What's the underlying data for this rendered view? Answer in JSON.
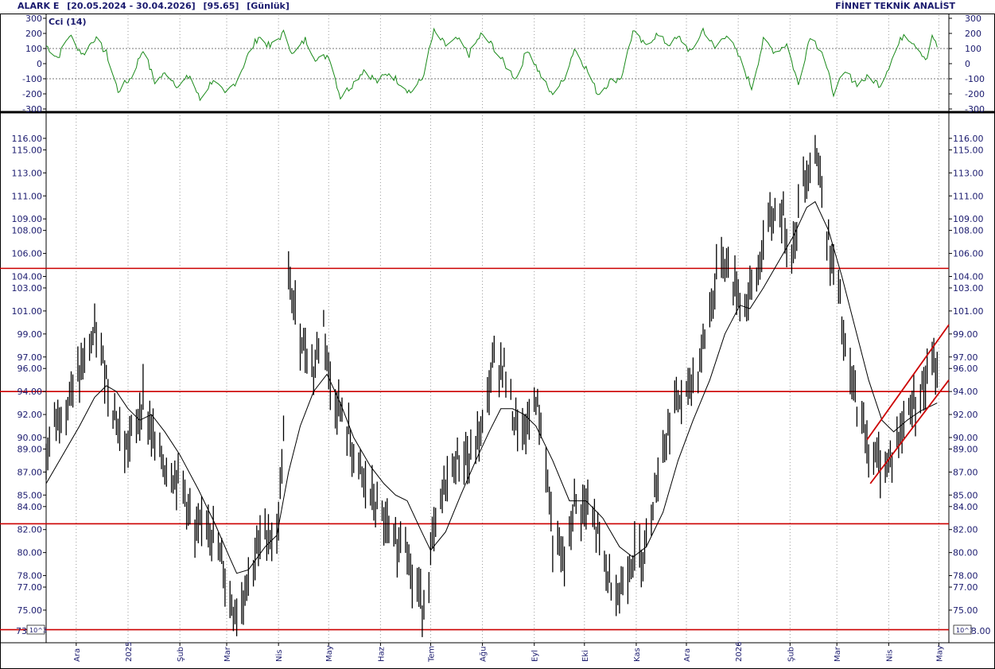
{
  "header": {
    "symbol": "ALARK E",
    "range": "[20.05.2024 - 30.04.2026]",
    "last": "[95.65]",
    "period": "[Günlük]",
    "brand": "FİNNET TEKNİK ANALİST"
  },
  "indicator": {
    "name": "Cci (14)",
    "color": "#1a8a1a",
    "ticks": [
      "300",
      "200",
      "100",
      "0",
      "-100",
      "-200",
      "-300"
    ],
    "tick_values": [
      300,
      200,
      100,
      0,
      -100,
      -200,
      -300
    ],
    "reference_lines": [
      100,
      -100
    ],
    "ylim": [
      -300,
      300
    ]
  },
  "price_axis": {
    "ticks": [
      "116.00",
      "115.00",
      "113.00",
      "111.00",
      "109.00",
      "108.00",
      "106.00",
      "104.00",
      "103.00",
      "101.00",
      "99.00",
      "97.00",
      "96.00",
      "94.00",
      "92.00",
      "90.00",
      "89.00",
      "87.00",
      "85.00",
      "84.00",
      "82.00",
      "80.00",
      "78.00",
      "77.00",
      "75.00"
    ],
    "tick_values": [
      116,
      115,
      113,
      111,
      109,
      108,
      106,
      104,
      103,
      101,
      99,
      97,
      96,
      94,
      92,
      90,
      89,
      87,
      85,
      84,
      82,
      80,
      78,
      77,
      75
    ],
    "bottom_left": "73",
    "bottom_right": "3.00",
    "multiplier": "10^3",
    "ylim": [
      73.2,
      118
    ]
  },
  "months": [
    "Ara",
    "2025",
    "Şub",
    "Mar",
    "Nis",
    "May",
    "Haz",
    "Tem",
    "Ağu",
    "Eyl",
    "Eki",
    "Kas",
    "Ara",
    "2026",
    "Şub",
    "Mar",
    "Nis",
    "May"
  ],
  "colors": {
    "bars": "#000000",
    "ma": "#000000",
    "hlines": "#cc0000",
    "axis_text": "#1a1a6e",
    "grid": "#999999"
  },
  "chart_data": {
    "type": "line",
    "title": "ALARK E [20.05.2024 - 30.04.2026] [95.65] [Günlük]",
    "xlabel": "",
    "ylabel": "",
    "ylim": [
      73.2,
      118
    ],
    "horizontal_levels": [
      104.7,
      94.0,
      82.5,
      73.3
    ],
    "channel": {
      "upper": {
        "from": [
          "2026-03-19",
          89.8
        ],
        "to": [
          "2026-05-07",
          99.8
        ]
      },
      "lower": {
        "from": [
          "2026-03-21",
          86.0
        ],
        "to": [
          "2026-05-07",
          95.0
        ]
      }
    },
    "price_path": [
      [
        "2024-11-13",
        88.0
      ],
      [
        "2024-11-18",
        91.5
      ],
      [
        "2024-11-27",
        93.5
      ],
      [
        "2024-12-06",
        96.5
      ],
      [
        "2024-12-12",
        99.0
      ],
      [
        "2024-12-18",
        96.0
      ],
      [
        "2024-12-25",
        91.5
      ],
      [
        "2024-12-30",
        89.0
      ],
      [
        "2025-01-06",
        91.0
      ],
      [
        "2025-01-10",
        93.5
      ],
      [
        "2025-01-16",
        90.0
      ],
      [
        "2025-01-23",
        87.5
      ],
      [
        "2025-02-03",
        86.0
      ],
      [
        "2025-02-10",
        81.0
      ],
      [
        "2025-02-17",
        83.5
      ],
      [
        "2025-02-25",
        79.5
      ],
      [
        "2025-03-03",
        76.0
      ],
      [
        "2025-03-07",
        74.5
      ],
      [
        "2025-03-14",
        78.0
      ],
      [
        "2025-03-24",
        82.0
      ],
      [
        "2025-03-31",
        81.0
      ],
      [
        "2025-04-04",
        90.0
      ],
      [
        "2025-04-07",
        103.5
      ],
      [
        "2025-04-14",
        99.0
      ],
      [
        "2025-04-22",
        96.0
      ],
      [
        "2025-04-28",
        100.0
      ],
      [
        "2025-05-02",
        94.5
      ],
      [
        "2025-05-12",
        90.5
      ],
      [
        "2025-05-19",
        87.0
      ],
      [
        "2025-05-26",
        85.0
      ],
      [
        "2025-06-03",
        82.5
      ],
      [
        "2025-06-10",
        80.5
      ],
      [
        "2025-06-16",
        82.0
      ],
      [
        "2025-06-20",
        77.5
      ],
      [
        "2025-06-27",
        75.5
      ],
      [
        "2025-07-03",
        81.5
      ],
      [
        "2025-07-10",
        86.0
      ],
      [
        "2025-07-18",
        88.5
      ],
      [
        "2025-07-25",
        88.0
      ],
      [
        "2025-08-01",
        91.0
      ],
      [
        "2025-08-08",
        97.0
      ],
      [
        "2025-08-14",
        96.0
      ],
      [
        "2025-08-20",
        91.5
      ],
      [
        "2025-08-26",
        90.0
      ],
      [
        "2025-09-02",
        93.5
      ],
      [
        "2025-09-08",
        88.0
      ],
      [
        "2025-09-12",
        81.0
      ],
      [
        "2025-09-19",
        79.0
      ],
      [
        "2025-09-25",
        84.0
      ],
      [
        "2025-10-02",
        84.0
      ],
      [
        "2025-10-08",
        82.0
      ],
      [
        "2025-10-15",
        78.0
      ],
      [
        "2025-10-22",
        76.5
      ],
      [
        "2025-10-29",
        79.5
      ],
      [
        "2025-11-05",
        80.0
      ],
      [
        "2025-11-10",
        84.0
      ],
      [
        "2025-11-17",
        89.0
      ],
      [
        "2025-11-24",
        93.0
      ],
      [
        "2025-12-01",
        93.5
      ],
      [
        "2025-12-08",
        96.0
      ],
      [
        "2025-12-15",
        101.0
      ],
      [
        "2025-12-22",
        106.0
      ],
      [
        "2025-12-29",
        103.5
      ],
      [
        "2026-01-05",
        101.5
      ],
      [
        "2026-01-12",
        104.0
      ],
      [
        "2026-01-19",
        108.5
      ],
      [
        "2026-01-26",
        110.0
      ],
      [
        "2026-02-02",
        106.0
      ],
      [
        "2026-02-09",
        112.5
      ],
      [
        "2026-02-16",
        115.0
      ],
      [
        "2026-02-20",
        112.0
      ],
      [
        "2026-02-25",
        105.5
      ],
      [
        "2026-03-02",
        103.0
      ],
      [
        "2026-03-06",
        97.0
      ],
      [
        "2026-03-12",
        93.5
      ],
      [
        "2026-03-18",
        90.0
      ],
      [
        "2026-03-24",
        88.0
      ],
      [
        "2026-03-30",
        87.5
      ],
      [
        "2026-04-06",
        89.5
      ],
      [
        "2026-04-13",
        92.5
      ],
      [
        "2026-04-20",
        94.0
      ],
      [
        "2026-04-27",
        96.0
      ],
      [
        "2026-04-30",
        95.65
      ]
    ],
    "moving_average": [
      [
        "2024-11-13",
        86.0
      ],
      [
        "2024-11-23",
        88.5
      ],
      [
        "2024-12-03",
        91.0
      ],
      [
        "2024-12-12",
        93.5
      ],
      [
        "2024-12-19",
        94.5
      ],
      [
        "2024-12-25",
        94.0
      ],
      [
        "2025-01-01",
        92.5
      ],
      [
        "2025-01-08",
        91.5
      ],
      [
        "2025-01-15",
        92.0
      ],
      [
        "2025-01-23",
        90.5
      ],
      [
        "2025-02-01",
        88.5
      ],
      [
        "2025-02-12",
        85.5
      ],
      [
        "2025-02-22",
        82.5
      ],
      [
        "2025-03-03",
        79.5
      ],
      [
        "2025-03-07",
        78.2
      ],
      [
        "2025-03-14",
        78.5
      ],
      [
        "2025-03-24",
        80.5
      ],
      [
        "2025-03-31",
        81.5
      ],
      [
        "2025-04-07",
        87.0
      ],
      [
        "2025-04-14",
        91.0
      ],
      [
        "2025-04-22",
        94.0
      ],
      [
        "2025-04-30",
        95.5
      ],
      [
        "2025-05-08",
        93.0
      ],
      [
        "2025-05-16",
        90.0
      ],
      [
        "2025-05-26",
        87.5
      ],
      [
        "2025-06-03",
        86.0
      ],
      [
        "2025-06-10",
        85.0
      ],
      [
        "2025-06-17",
        84.5
      ],
      [
        "2025-06-25",
        82.0
      ],
      [
        "2025-07-01",
        80.2
      ],
      [
        "2025-07-10",
        81.8
      ],
      [
        "2025-07-19",
        85.0
      ],
      [
        "2025-07-28",
        88.0
      ],
      [
        "2025-08-05",
        90.5
      ],
      [
        "2025-08-12",
        92.5
      ],
      [
        "2025-08-19",
        92.5
      ],
      [
        "2025-08-26",
        92.0
      ],
      [
        "2025-09-02",
        91.0
      ],
      [
        "2025-09-12",
        88.0
      ],
      [
        "2025-09-22",
        84.5
      ],
      [
        "2025-10-02",
        84.5
      ],
      [
        "2025-10-12",
        83.0
      ],
      [
        "2025-10-22",
        80.5
      ],
      [
        "2025-10-30",
        79.6
      ],
      [
        "2025-11-07",
        80.5
      ],
      [
        "2025-11-17",
        83.5
      ],
      [
        "2025-11-26",
        88.0
      ],
      [
        "2025-12-05",
        91.5
      ],
      [
        "2025-12-15",
        95.0
      ],
      [
        "2025-12-24",
        99.0
      ],
      [
        "2026-01-02",
        101.5
      ],
      [
        "2026-01-08",
        101.2
      ],
      [
        "2026-01-16",
        103.0
      ],
      [
        "2026-01-26",
        105.5
      ],
      [
        "2026-02-03",
        107.5
      ],
      [
        "2026-02-11",
        110.0
      ],
      [
        "2026-02-16",
        110.5
      ],
      [
        "2026-02-24",
        108.0
      ],
      [
        "2026-03-04",
        104.0
      ],
      [
        "2026-03-12",
        99.5
      ],
      [
        "2026-03-20",
        95.0
      ],
      [
        "2026-03-28",
        91.5
      ],
      [
        "2026-04-04",
        90.5
      ],
      [
        "2026-04-12",
        91.5
      ],
      [
        "2026-04-20",
        92.3
      ],
      [
        "2026-04-30",
        93.0
      ]
    ],
    "cci_path": [
      [
        "2024-11-13",
        120
      ],
      [
        "2024-11-20",
        40
      ],
      [
        "2024-11-27",
        190
      ],
      [
        "2024-12-05",
        60
      ],
      [
        "2024-12-12",
        170
      ],
      [
        "2024-12-19",
        70
      ],
      [
        "2024-12-26",
        -180
      ],
      [
        "2025-01-03",
        -90
      ],
      [
        "2025-01-10",
        100
      ],
      [
        "2025-01-17",
        -120
      ],
      [
        "2025-01-24",
        -60
      ],
      [
        "2025-01-31",
        -150
      ],
      [
        "2025-02-07",
        -80
      ],
      [
        "2025-02-13",
        -240
      ],
      [
        "2025-02-21",
        -100
      ],
      [
        "2025-02-28",
        -210
      ],
      [
        "2025-03-07",
        -110
      ],
      [
        "2025-03-14",
        60
      ],
      [
        "2025-03-20",
        180
      ],
      [
        "2025-03-27",
        110
      ],
      [
        "2025-04-04",
        200
      ],
      [
        "2025-04-10",
        60
      ],
      [
        "2025-04-17",
        160
      ],
      [
        "2025-04-24",
        20
      ],
      [
        "2025-05-01",
        60
      ],
      [
        "2025-05-08",
        -220
      ],
      [
        "2025-05-15",
        -140
      ],
      [
        "2025-05-22",
        -40
      ],
      [
        "2025-05-30",
        -120
      ],
      [
        "2025-06-06",
        -60
      ],
      [
        "2025-06-13",
        -130
      ],
      [
        "2025-06-19",
        -190
      ],
      [
        "2025-06-26",
        -100
      ],
      [
        "2025-07-03",
        210
      ],
      [
        "2025-07-10",
        120
      ],
      [
        "2025-07-17",
        160
      ],
      [
        "2025-07-24",
        60
      ],
      [
        "2025-07-31",
        190
      ],
      [
        "2025-08-07",
        120
      ],
      [
        "2025-08-14",
        0
      ],
      [
        "2025-08-21",
        -100
      ],
      [
        "2025-08-28",
        100
      ],
      [
        "2025-09-04",
        -60
      ],
      [
        "2025-09-11",
        -200
      ],
      [
        "2025-09-18",
        -120
      ],
      [
        "2025-09-25",
        100
      ],
      [
        "2025-10-02",
        -30
      ],
      [
        "2025-10-09",
        -200
      ],
      [
        "2025-10-16",
        -120
      ],
      [
        "2025-10-23",
        -90
      ],
      [
        "2025-10-30",
        210
      ],
      [
        "2025-11-06",
        120
      ],
      [
        "2025-11-13",
        190
      ],
      [
        "2025-11-20",
        130
      ],
      [
        "2025-11-27",
        170
      ],
      [
        "2025-12-04",
        70
      ],
      [
        "2025-12-11",
        230
      ],
      [
        "2025-12-18",
        100
      ],
      [
        "2025-12-25",
        200
      ],
      [
        "2026-01-02",
        30
      ],
      [
        "2026-01-09",
        -160
      ],
      [
        "2026-01-16",
        150
      ],
      [
        "2026-01-23",
        80
      ],
      [
        "2026-01-30",
        130
      ],
      [
        "2026-02-06",
        -140
      ],
      [
        "2026-02-13",
        190
      ],
      [
        "2026-02-20",
        80
      ],
      [
        "2026-02-27",
        -190
      ],
      [
        "2026-03-06",
        -60
      ],
      [
        "2026-03-13",
        -130
      ],
      [
        "2026-03-20",
        -90
      ],
      [
        "2026-03-27",
        -140
      ],
      [
        "2026-04-03",
        30
      ],
      [
        "2026-04-10",
        200
      ],
      [
        "2026-04-17",
        130
      ],
      [
        "2026-04-24",
        20
      ],
      [
        "2026-04-27",
        190
      ],
      [
        "2026-04-30",
        100
      ]
    ]
  }
}
